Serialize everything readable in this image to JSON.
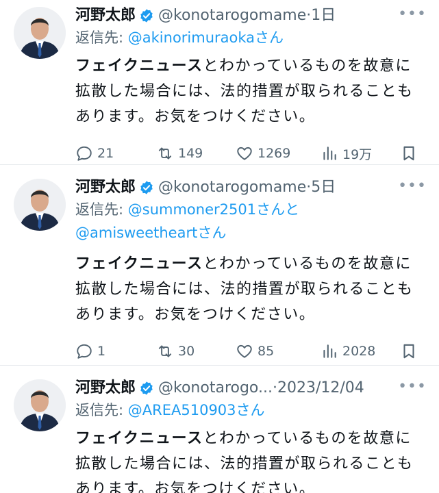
{
  "tweets": [
    {
      "name": "河野太郎",
      "handle": "@konotarogomame",
      "separator": "·",
      "time": "1日",
      "reply_prefix": "返信先: ",
      "reply_line1_mention": "@akinorimuraoka",
      "reply_line1_suffix": "さん",
      "reply_line2_mention": "",
      "reply_line2_suffix": "",
      "text_bold": "フェイクニュース",
      "text_rest1": "とわかっているものを故意に",
      "text_line2": "拡散した場合には、法的措置が取られることも",
      "text_line3": "あります。お気をつけください。",
      "replies": "21",
      "retweets": "149",
      "likes": "1269",
      "views": "19万"
    },
    {
      "name": "河野太郎",
      "handle": "@konotarogomame",
      "separator": "·",
      "time": "5日",
      "reply_prefix": "返信先: ",
      "reply_line1_mention": "@summoner2501",
      "reply_line1_suffix": "さんと",
      "reply_line2_mention": "@amisweetheart",
      "reply_line2_suffix": "さん",
      "text_bold": "フェイクニュース",
      "text_rest1": "とわかっているものを故意に",
      "text_line2": "拡散した場合には、法的措置が取られることも",
      "text_line3": "あります。お気をつけください。",
      "replies": "1",
      "retweets": "30",
      "likes": "85",
      "views": "2028"
    },
    {
      "name": "河野太郎",
      "handle": "@konotarogo...",
      "separator": "·",
      "time": "2023/12/04",
      "reply_prefix": "返信先: ",
      "reply_line1_mention": "@AREA510903",
      "reply_line1_suffix": "さん",
      "reply_line2_mention": "",
      "reply_line2_suffix": "",
      "text_bold": "フェイクニュース",
      "text_rest1": "とわかっているものを故意に",
      "text_line2": "拡散した場合には、法的措置が取られることも",
      "text_line3": "あります。お気をつけください。"
    }
  ],
  "more_glyph": "•••",
  "colors": {
    "accent": "#1d9bf0",
    "secondary_text": "#536471",
    "divider": "#e6e9ec"
  }
}
